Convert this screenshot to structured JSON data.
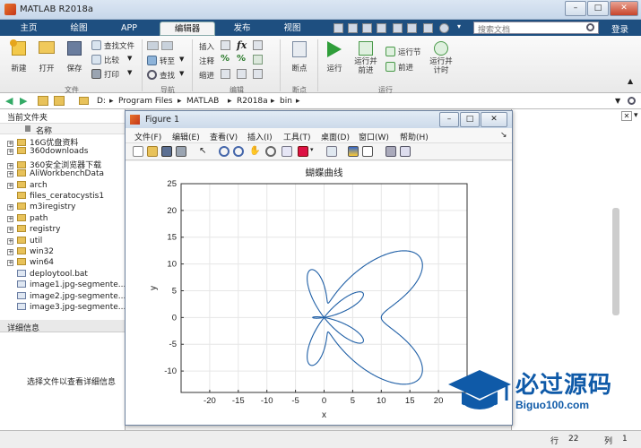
{
  "window": {
    "title": "MATLAB R2018a"
  },
  "tabs": [
    "主页",
    "绘图",
    "APP",
    "编辑器",
    "发布",
    "视图"
  ],
  "search": {
    "placeholder": "搜索文档",
    "login": "登录"
  },
  "ribbon": {
    "file_group": {
      "name": "文件",
      "new": "新建",
      "open": "打开",
      "save": "保存",
      "find_files": "查找文件",
      "compare": "比较",
      "print": "打印"
    },
    "nav_group": {
      "name": "导航",
      "goto": "转至",
      "find": "查找"
    },
    "edit_group": {
      "name": "编辑",
      "insert": "插入",
      "comment": "注释",
      "indent": "缩进",
      "fx": "fx"
    },
    "bp_group": {
      "name": "断点",
      "breakpoint": "断点"
    },
    "run_group": {
      "name": "运行",
      "run": "运行",
      "run_advance": "运行并前进",
      "run_section": "运行节",
      "advance": "前进",
      "run_time": "运行并计时"
    }
  },
  "address": {
    "path": [
      "D:",
      "Program Files",
      "MATLAB",
      "R2018a",
      "bin"
    ]
  },
  "current_folder": {
    "title": "当前文件夹",
    "col_name": "名称",
    "items": [
      {
        "name": "16G优盘资料",
        "type": "folder",
        "exp": true
      },
      {
        "name": "360downloads",
        "type": "folder",
        "exp": true
      },
      {
        "name": "360安全浏览器下载",
        "type": "folder",
        "exp": true
      },
      {
        "name": "AliWorkbenchData",
        "type": "folder",
        "exp": true
      },
      {
        "name": "arch",
        "type": "folder",
        "exp": true
      },
      {
        "name": "files_ceratocystis1",
        "type": "folder",
        "exp": false
      },
      {
        "name": "m3iregistry",
        "type": "folder",
        "exp": true
      },
      {
        "name": "path",
        "type": "folder",
        "exp": true
      },
      {
        "name": "registry",
        "type": "folder",
        "exp": true
      },
      {
        "name": "util",
        "type": "folder",
        "exp": true
      },
      {
        "name": "win32",
        "type": "folder",
        "exp": true
      },
      {
        "name": "win64",
        "type": "folder",
        "exp": true
      },
      {
        "name": "deploytool.bat",
        "type": "file",
        "exp": false
      },
      {
        "name": "image1.jpg-segmente...",
        "type": "file",
        "exp": false
      },
      {
        "name": "image2.jpg-segmente...",
        "type": "file",
        "exp": false
      },
      {
        "name": "image3.jpg-segmente...",
        "type": "file",
        "exp": false
      }
    ]
  },
  "details": {
    "title": "详细信息",
    "hint": "选择文件以查看详细信息"
  },
  "figure": {
    "title": "Figure 1",
    "menu": [
      "文件(F)",
      "编辑(E)",
      "查看(V)",
      "插入(I)",
      "工具(T)",
      "桌面(D)",
      "窗口(W)",
      "帮助(H)"
    ]
  },
  "statusbar": {
    "row_label": "行",
    "row": "22",
    "col_label": "列",
    "col": "1"
  },
  "watermark": {
    "cn": "必过源码",
    "en": "Biguo100.com"
  },
  "chart_data": {
    "type": "line",
    "title": "蝴蝶曲线",
    "xlabel": "x",
    "ylabel": "y",
    "xlim": [
      -25,
      25
    ],
    "ylim": [
      -14,
      25
    ],
    "xticks": [
      -20,
      -15,
      -10,
      -5,
      0,
      5,
      10,
      15,
      20
    ],
    "yticks": [
      -10,
      -5,
      0,
      5,
      10,
      15,
      20,
      25
    ],
    "curve": "r = 12*sin(2.5*t)^2 + 10*cos(t), x = r*cos(t), y = r*sin(t), t in [0, 2π]",
    "color": "#1f5fa6",
    "grid": true
  },
  "colors": {
    "tab_bar": "#1e4f80",
    "accent": "#1f5fa6"
  }
}
